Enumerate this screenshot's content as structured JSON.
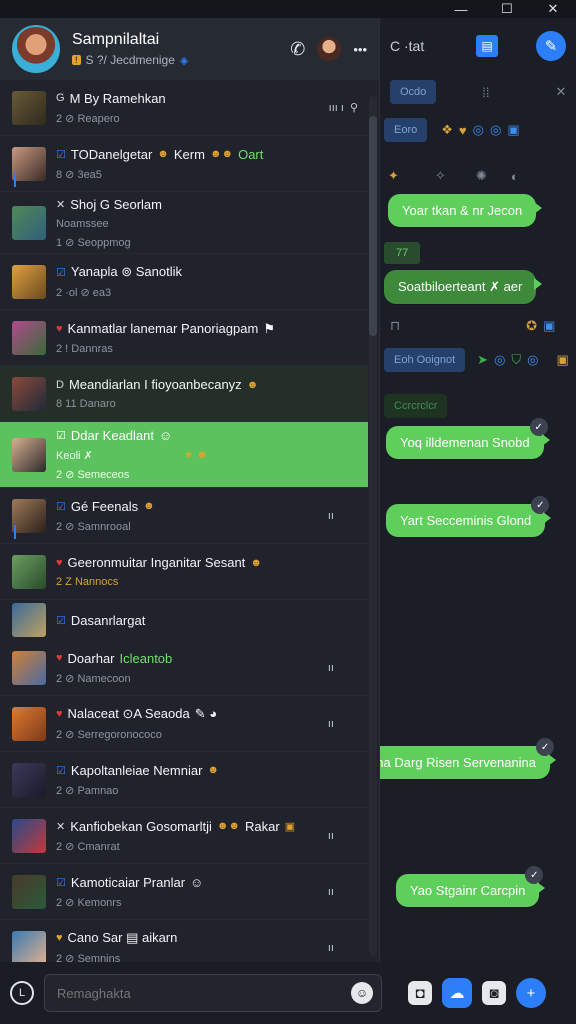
{
  "window": {
    "minimize": "—",
    "maximize": "☐",
    "close": "✕"
  },
  "header": {
    "title": "Sampnilaltai",
    "subtitle": "S ?/ Jecdmenige",
    "badge": "!",
    "call_icon": "phone-icon",
    "more_label": "•••"
  },
  "right_header": {
    "text": "C ·tat",
    "btn1": "▤",
    "btn2": "✎"
  },
  "right_ghost": {
    "chip1": "Ocdo",
    "chip2": "Eoro",
    "chip3": "Eoh Ooignot",
    "chip4": "Ccrcrclcr",
    "green_chip": "77"
  },
  "bubbles": [
    {
      "text": "Yoar tkan & nr Jecon",
      "react": ""
    },
    {
      "text": "Soatbiloerteant ✗ aer",
      "react": ""
    },
    {
      "text": "Yoq illdemenan Snobd",
      "react": "✓"
    },
    {
      "text": "Yart Secceminis Glond",
      "react": "✓"
    },
    {
      "text": "Sheo Avaina Darg Risen Servenanina",
      "react": "✓"
    },
    {
      "text": "Yao Stgainr Carcpin",
      "react": "✓"
    }
  ],
  "chats": [
    {
      "title": "M By Ramehkan",
      "prefix": "G",
      "sub": "2 ⊘ Reapero",
      "meta": "ııı ı",
      "active": false
    },
    {
      "title": "TODanelgetar",
      "title_extra": "Kerm",
      "accent": "Oart",
      "prefix": "☑",
      "sub": "8 ⊘ 3ea5",
      "meta": "",
      "active": false
    },
    {
      "title": "Shoj G Seorlam",
      "prefix": "✕",
      "sub": "Noamssee",
      "sub2": "1 ⊘ Seoppmog",
      "meta": "",
      "active": false
    },
    {
      "title": "Yanapla ⊚ Sanotlik",
      "prefix": "☑",
      "sub": "2 ·ol ⊘ ea3",
      "meta": "",
      "active": false
    },
    {
      "title": "Kanmatlar lanemar Panoriagpam",
      "prefix": "♥",
      "sub": "2 ! Dannras",
      "meta": "",
      "active": false
    },
    {
      "title": "Meandiarlan I fioyoanbecanyz",
      "prefix": "D",
      "sub": "8 11 Danaro",
      "meta": "",
      "active": false
    },
    {
      "title": "Ddar Keadlant",
      "prefix": "☑",
      "sub": "Keoli ✗",
      "sub2": "2 ⊘ Semeceos",
      "meta": "",
      "active": true
    },
    {
      "title": "Gé Feenals",
      "prefix": "☑",
      "sub": "2 ⊘ Samnrooal",
      "meta": "ıı",
      "active": false
    },
    {
      "title": "Geeronmuitar Inganitar Sesant",
      "prefix": "♥",
      "sub": "2 Z Nannocs",
      "meta": "",
      "active": false
    },
    {
      "title": "Dasanrlargat",
      "prefix": "☑",
      "sub": "",
      "meta": "",
      "active": false
    },
    {
      "title": "Doarhar",
      "accent": "Icleantob",
      "prefix": "♥",
      "sub": "2 ⊘ Namecoon",
      "meta": "ıı",
      "active": false
    },
    {
      "title": "Nalaceat ⊙A Seaoda",
      "prefix": "♥",
      "sub": "2 ⊘ Serregoronococo",
      "meta": "ıı",
      "active": false
    },
    {
      "title": "Kapoltanleiae Nemniar",
      "prefix": "☑",
      "sub": "2 ⊘ Pamnao",
      "meta": "",
      "active": false
    },
    {
      "title": "Kanfiobekan Gosomarltji",
      "title_extra": "Rakar",
      "prefix": "✕",
      "sub": "2 ⊘ Cmanrat",
      "meta": "ıı",
      "active": false
    },
    {
      "title": "Kamoticaiar Pranlar",
      "prefix": "☑",
      "sub": "2 ⊘ Kemonrs",
      "meta": "ıı",
      "active": false
    },
    {
      "title": "Cano Sar ▤ aikarn",
      "prefix": "♥",
      "sub": "2 ⊘ Semnins",
      "meta": "ıı",
      "active": false
    }
  ],
  "composer": {
    "placeholder": "Remaghakta",
    "value": ""
  },
  "colors": {
    "accent": "#2d7ff9",
    "bubble": "#5fcf5b",
    "active_row": "#5cc25e"
  }
}
